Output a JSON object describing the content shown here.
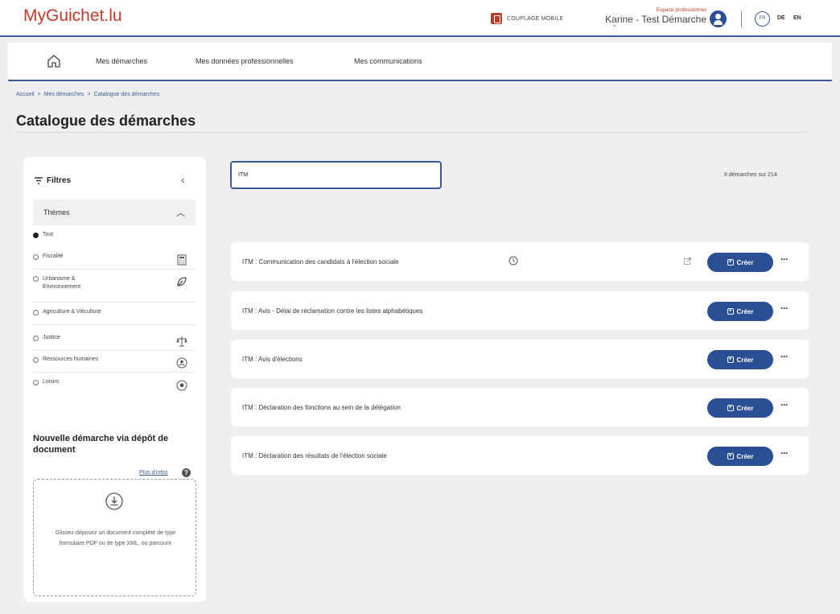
{
  "header": {
    "logo": "MyGuichet.lu",
    "mobile_coupling": "COUPLAGE MOBILE",
    "user_space": "Espace professionnel",
    "user_name": "Karine - Test Démarche",
    "lang_current": "FR",
    "lang_de": "DE",
    "lang_en": "EN"
  },
  "nav": {
    "items": [
      "Mes démarches",
      "Mes données professionnelles",
      "Mes communications"
    ]
  },
  "breadcrumb": [
    "Accueil",
    "Mes démarches",
    "Catalogue des démarches"
  ],
  "breadcrumb_sep": ">",
  "page_title": "Catalogue des démarches",
  "filters": {
    "title": "Filtres",
    "themes_label": "Thèmes",
    "themes": [
      {
        "label": "Tout",
        "selected": true,
        "icon": ""
      },
      {
        "label": "Fiscalité",
        "selected": false,
        "icon": "calculator-icon"
      },
      {
        "label": "Urbanisme & Environnement",
        "selected": false,
        "icon": "leaf-icon"
      },
      {
        "label": "Agriculture & Viticulture",
        "selected": false,
        "icon": ""
      },
      {
        "label": "Justice",
        "selected": false,
        "icon": "scales-icon"
      },
      {
        "label": "Ressources humaines",
        "selected": false,
        "icon": "people-icon"
      },
      {
        "label": "Loisirs",
        "selected": false,
        "icon": "ball-icon"
      }
    ]
  },
  "upload": {
    "title": "Nouvelle démarche via dépôt de document",
    "more_info": "Plus d'infos",
    "text": "Glissez-déposez un document complété de type formulaire PDF ou de type XML, ou parcourir"
  },
  "search": {
    "value": "ITM"
  },
  "results_count": "8 démarches sur 214",
  "results": [
    {
      "title": "ITM : Communication des candidats à l'élection sociale",
      "history": true,
      "external": true
    },
    {
      "title": "ITM : Avis - Délai de réclamation contre les listes alphabétiques",
      "history": false,
      "external": false
    },
    {
      "title": "ITM : Avis d'élections",
      "history": false,
      "external": false
    },
    {
      "title": "ITM : Déclaration des fonctions au sein de la délégation",
      "history": false,
      "external": false
    },
    {
      "title": "ITM : Déclaration des résultats de l'élection sociale",
      "history": false,
      "external": false
    }
  ],
  "create_label": "Créer",
  "more_label": "···",
  "colors": {
    "brand_red": "#c0392b",
    "primary_blue": "#2b4f95"
  }
}
